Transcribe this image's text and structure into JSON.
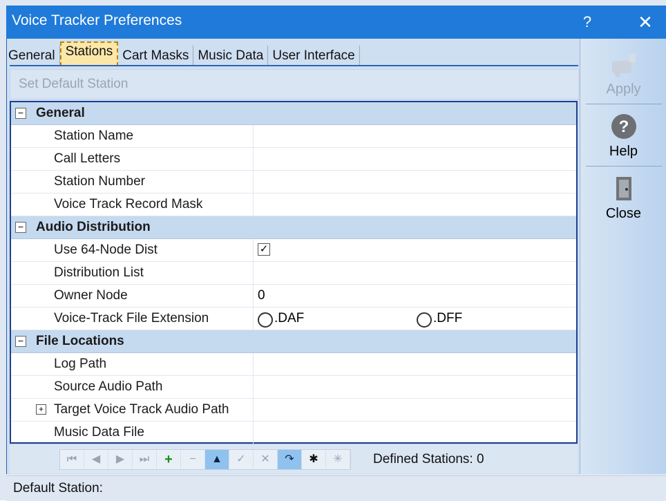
{
  "window": {
    "title": "Voice Tracker Preferences",
    "help_glyph": "?",
    "close_glyph": "✕"
  },
  "tabs": [
    {
      "label": "General"
    },
    {
      "label": "Stations"
    },
    {
      "label": "Cart Masks"
    },
    {
      "label": "Music Data"
    },
    {
      "label": "User Interface"
    }
  ],
  "toolbar": {
    "set_default": "Set Default Station"
  },
  "sections": {
    "general": {
      "label": "General",
      "toggle": "−"
    },
    "audio": {
      "label": "Audio Distribution",
      "toggle": "−"
    },
    "files": {
      "label": "File Locations",
      "toggle": "−"
    }
  },
  "general_props": [
    {
      "name": "Station Name",
      "value": ""
    },
    {
      "name": "Call Letters",
      "value": ""
    },
    {
      "name": "Station Number",
      "value": ""
    },
    {
      "name": "Voice Track Record Mask",
      "value": ""
    }
  ],
  "audio_props": {
    "use64": {
      "name": "Use 64-Node Dist",
      "checked": true,
      "check_glyph": "✓"
    },
    "distlist": {
      "name": "Distribution List",
      "value": ""
    },
    "owner": {
      "name": "Owner Node",
      "value": "0"
    },
    "ext": {
      "name": "Voice-Track File Extension",
      "opt1": ".DAF",
      "opt2": ".DFF"
    }
  },
  "file_props": [
    {
      "name": "Log Path",
      "value": ""
    },
    {
      "name": "Source Audio Path",
      "value": ""
    },
    {
      "name": "Target Voice Track Audio Path",
      "value": "",
      "expander": "+"
    },
    {
      "name": "Music Data File",
      "value": ""
    }
  ],
  "navbar": {
    "buttons": [
      "⏮",
      "◀",
      "▶",
      "⏭",
      "+",
      "−",
      "▲",
      "✓",
      "✕",
      "↷",
      "✱",
      "✳"
    ],
    "defined": "Defined Stations: 0"
  },
  "side": {
    "apply": "Apply",
    "help": "Help",
    "close": "Close"
  },
  "status": {
    "text": "Default Station:"
  },
  "colors": {
    "titlebar": "#1f7ad9",
    "section": "#c5d9ef",
    "grid_border": "#1d3f8f"
  }
}
